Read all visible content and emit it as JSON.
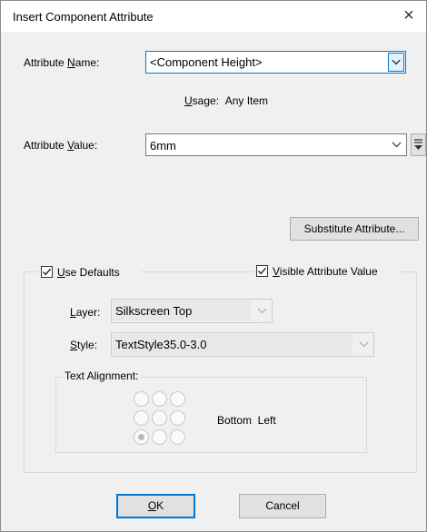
{
  "window": {
    "title": "Insert Component Attribute",
    "close_glyph": "×"
  },
  "attribute_name": {
    "label_pre": "Attribute ",
    "label_ul": "N",
    "label_post": "ame:",
    "value": "<Component Height>"
  },
  "usage": {
    "label_ul": "U",
    "label_post": "sage:",
    "value": "Any Item"
  },
  "attribute_value": {
    "label_pre": "Attribute ",
    "label_ul": "V",
    "label_post": "alue:",
    "value": "6mm"
  },
  "substitute_button": {
    "label": "Substitute Attribute..."
  },
  "use_defaults": {
    "label_ul": "U",
    "label_post": "se Defaults",
    "checked": true
  },
  "visible_attribute": {
    "label_ul": "V",
    "label_post": "isible Attribute Value",
    "checked": true
  },
  "layer": {
    "label_ul": "L",
    "label_post": "ayer:",
    "value": "Silkscreen Top"
  },
  "style": {
    "label_ul": "S",
    "label_post": "tyle:",
    "value": "TextStyle35.0-3.0"
  },
  "text_alignment": {
    "label": "Text Alignment:",
    "selected": "Bottom  Left",
    "selected_index": 6
  },
  "buttons": {
    "ok_label": "OK",
    "ok_ul": "O",
    "ok_post": "K",
    "cancel_label": "Cancel"
  },
  "colors": {
    "accent": "#0078d7",
    "dialog_bg": "#f0f0f0"
  }
}
